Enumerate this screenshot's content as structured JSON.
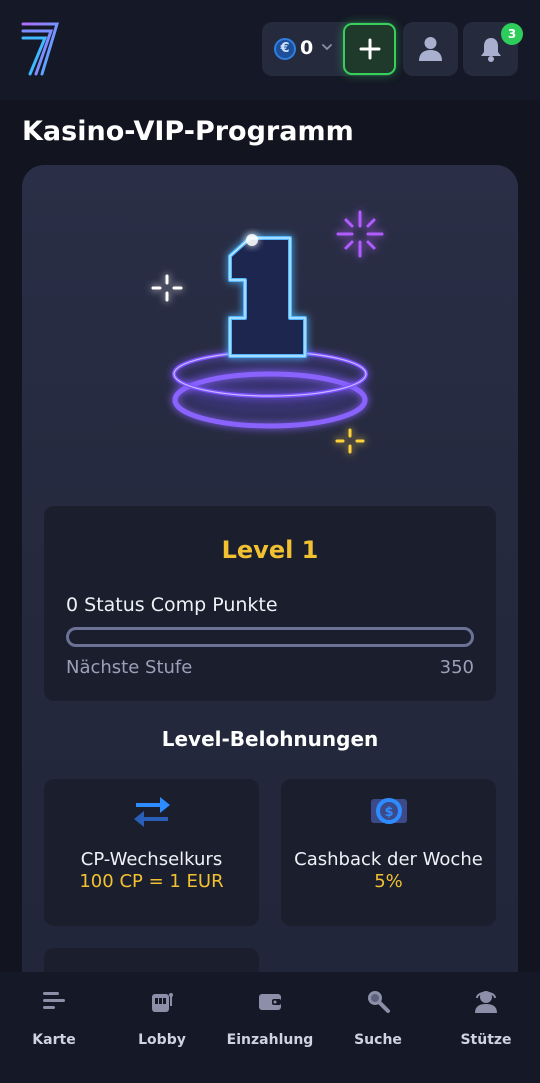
{
  "header": {
    "balance_currency_symbol": "€",
    "balance_value": "0",
    "notification_count": "3"
  },
  "page": {
    "title": "Kasino-VIP-Programm"
  },
  "vip": {
    "level_title": "Level 1",
    "points_text": "0 Status Comp Punkte",
    "progress_fraction": 0,
    "next_label": "Nächste Stufe",
    "next_value": "350"
  },
  "rewards": {
    "title": "Level-Belohnungen",
    "items": [
      {
        "label": "CP-Wechselkurs",
        "value": "100 CP = 1 EUR",
        "icon": "exchange-arrows-icon"
      },
      {
        "label": "Cashback der Woche",
        "value": "5%",
        "icon": "cashback-money-icon"
      },
      {
        "label": "",
        "value": "",
        "icon": "reward-badge-icon"
      }
    ]
  },
  "nav": {
    "items": [
      {
        "label": "Karte",
        "icon": "menu-icon"
      },
      {
        "label": "Lobby",
        "icon": "slot-machine-icon"
      },
      {
        "label": "Einzahlung",
        "icon": "wallet-icon"
      },
      {
        "label": "Suche",
        "icon": "search-icon"
      },
      {
        "label": "Stütze",
        "icon": "support-agent-icon"
      }
    ]
  },
  "colors": {
    "accent_gold": "#f2c132",
    "deposit_green": "#36d05a",
    "badge_green": "#2ecc5a",
    "background": "#12141f",
    "card": "#2a2e46"
  }
}
